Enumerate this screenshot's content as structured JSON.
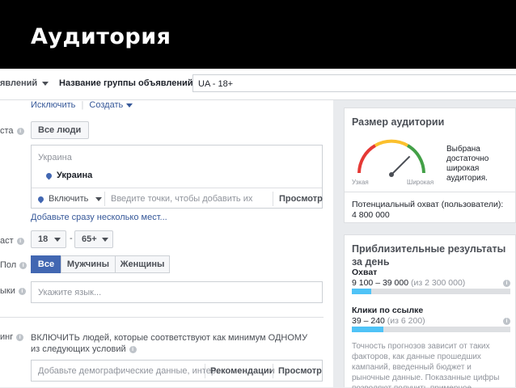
{
  "header": {
    "title": "Аудитория"
  },
  "topbar": {
    "prev_label": "явлений",
    "adset_name_label": "Название группы объявлений",
    "adset_name_value": "UA - 18+"
  },
  "form": {
    "links": {
      "exclude": "Исключить",
      "create": "Создать"
    },
    "location": {
      "label": "ста",
      "select": "Все люди",
      "country_header": "Украина",
      "country_item": "Украина",
      "include": "Включить",
      "placeholder": "Введите точки, чтобы добавить их",
      "browse": "Просмотр",
      "bulk_link": "Добавьте сразу несколько мест..."
    },
    "age": {
      "label": "аст",
      "min": "18",
      "dash": "-",
      "max": "65+"
    },
    "gender": {
      "label": "Пол",
      "options": [
        "Все",
        "Мужчины",
        "Женщины"
      ]
    },
    "language": {
      "label": "ыки",
      "placeholder": "Укажите язык..."
    },
    "targeting": {
      "label": "инг",
      "text": "ВКЛЮЧИТЬ людей, которые соответствуют как минимум ОДНОМУ из следующих условий",
      "placeholder": "Добавьте демографические данные, интер...",
      "suggestions": "Рекомендации",
      "browse": "Просмотр"
    }
  },
  "audience_size": {
    "title": "Размер аудитории",
    "level": 0.75,
    "narrow": "Узкая",
    "broad": "Широкая",
    "description": "Выбрана достаточно широкая аудитория.",
    "potential_label": "Потенциальный охват (пользователи):",
    "potential_value": "4 800 000"
  },
  "daily_results": {
    "title": "Приблизительные результаты за день",
    "reach": {
      "label": "Охват",
      "range": "9 100 – 39 000",
      "of": "(из 2 300 000)",
      "fill_percent": 12
    },
    "clicks": {
      "label": "Клики по ссылке",
      "range": "39 – 240",
      "of": "(из 6 200)",
      "fill_percent": 20
    },
    "note": "Точность прогнозов зависит от таких факторов, как данные прошедших кампаний, введенный бюджет и рыночные данные. Показанные цифры позволяют получить примерное представление о"
  },
  "colors": {
    "link": "#365899",
    "accent_bar": "#4fc3f7",
    "gauge_red": "#e53935",
    "gauge_yellow": "#fbc02d",
    "gauge_green": "#43a047"
  }
}
